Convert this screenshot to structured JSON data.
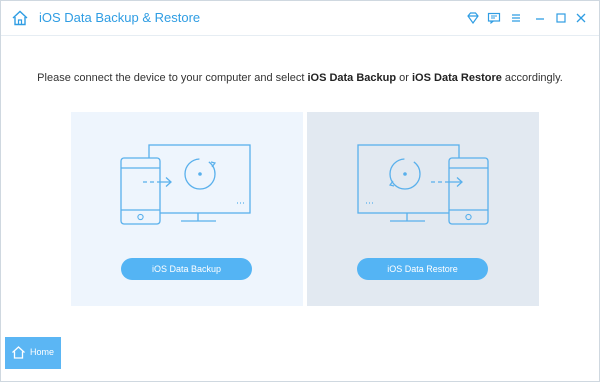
{
  "app": {
    "title": "iOS Data Backup & Restore"
  },
  "instruction": {
    "prefix": "Please connect the device to your computer and select ",
    "backup_bold": "iOS Data Backup",
    "middle": " or ",
    "restore_bold": "iOS Data Restore",
    "suffix": " accordingly."
  },
  "panels": {
    "backup": {
      "button_label": "iOS Data Backup"
    },
    "restore": {
      "button_label": "iOS Data Restore"
    }
  },
  "sidebar": {
    "home_label": "Home"
  },
  "colors": {
    "accent": "#2f9de3",
    "button": "#54b4f4",
    "panel_left": "#eef5fd",
    "panel_right": "#e2e9f1"
  },
  "icons": {
    "app": "home-icon",
    "titlebar": [
      "diamond-icon",
      "feedback-icon",
      "menu-icon",
      "minimize-icon",
      "close-icon"
    ],
    "backup_illustration": "phone-to-monitor-icon",
    "restore_illustration": "monitor-to-phone-icon"
  }
}
